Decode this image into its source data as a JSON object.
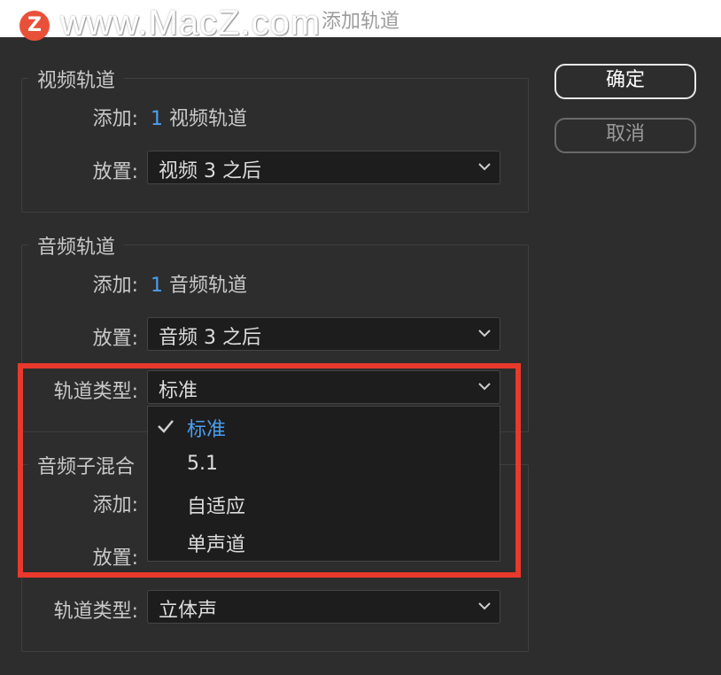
{
  "window": {
    "title": "添加轨道"
  },
  "watermark": {
    "logo": "Z",
    "text": "www.MacZ.com"
  },
  "buttons": {
    "ok": "确定",
    "cancel": "取消"
  },
  "video": {
    "legend": "视频轨道",
    "add_label": "添加:",
    "add_count": "1",
    "add_unit": "视频轨道",
    "place_label": "放置:",
    "place_value": "视频 3 之后"
  },
  "audio": {
    "legend": "音频轨道",
    "add_label": "添加:",
    "add_count": "1",
    "add_unit": "音频轨道",
    "place_label": "放置:",
    "place_value": "音频 3 之后",
    "type_label": "轨道类型:",
    "type_value": "标准",
    "type_options": [
      "标准",
      "5.1",
      "自适应",
      "单声道"
    ],
    "selected_index": 0
  },
  "submix": {
    "legend": "音频子混合",
    "add_label": "添加:",
    "place_label": "放置:",
    "type_label": "轨道类型:",
    "type_value": "立体声"
  },
  "colors": {
    "accent": "#4a9ff0",
    "highlight": "#e8392c"
  }
}
